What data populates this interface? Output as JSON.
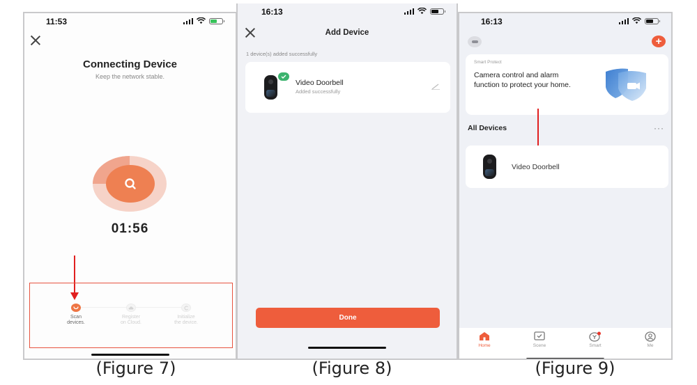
{
  "figures": [
    {
      "caption": "(Figure 7)",
      "status_time": "11:53",
      "title": "Connecting Device",
      "subtitle": "Keep the network stable.",
      "timer": "01:56",
      "steps": [
        {
          "label_line1": "Scan",
          "label_line2": "devices.",
          "state": "active"
        },
        {
          "label_line1": "Register",
          "label_line2": "on Cloud.",
          "state": "pending"
        },
        {
          "label_line1": "Initialize",
          "label_line2": "the device.",
          "state": "pending"
        }
      ]
    },
    {
      "caption": "(Figure 8)",
      "status_time": "16:13",
      "title": "Add Device",
      "added_note": "1 device(s) added successfully",
      "device": {
        "name": "Video Doorbell",
        "status": "Added successfully"
      },
      "done_label": "Done"
    },
    {
      "caption": "(Figure 9)",
      "status_time": "16:13",
      "promo": {
        "tag": "Smart Protect",
        "message": "Camera control and alarm function to protect your home."
      },
      "section_title": "All Devices",
      "more_label": "···",
      "add_label": "+",
      "device": {
        "name": "Video Doorbell"
      },
      "tabs": [
        {
          "label": "Home",
          "icon": "home-icon",
          "active": true
        },
        {
          "label": "Scene",
          "icon": "scene-icon",
          "active": false
        },
        {
          "label": "Smart",
          "icon": "smart-icon",
          "active": false
        },
        {
          "label": "Me",
          "icon": "profile-icon",
          "active": false
        }
      ]
    }
  ],
  "colors": {
    "accent": "#ee5d3c",
    "scan_orange": "#ee8052",
    "success_green": "#3cb36e",
    "annotation_red": "#e11f1f"
  }
}
